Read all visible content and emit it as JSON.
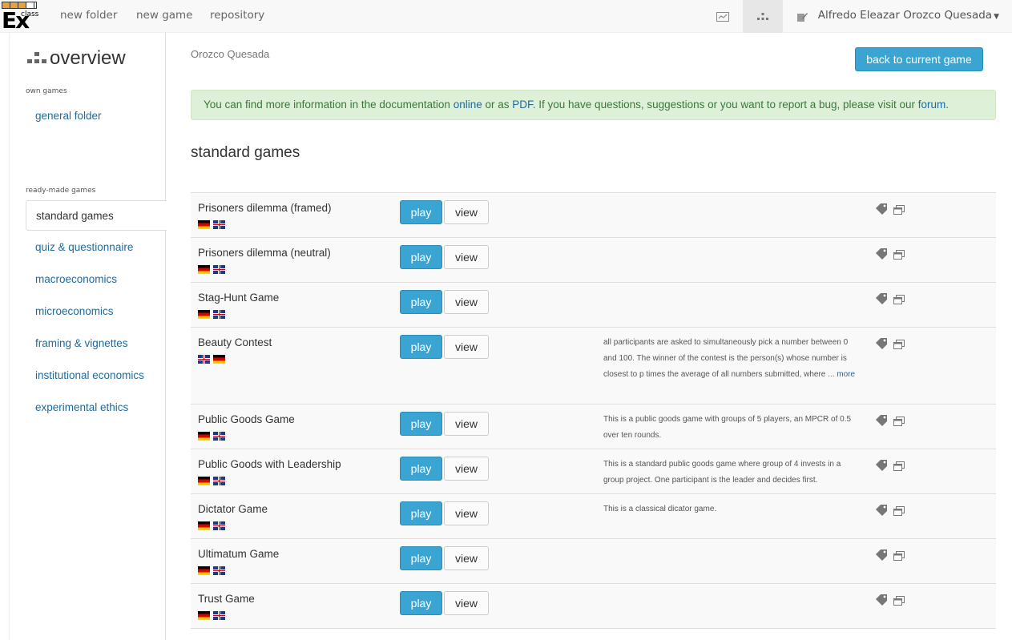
{
  "topnav": {
    "logo": {
      "text": "Ex",
      "small": "class"
    },
    "links": [
      "new folder",
      "new game",
      "repository"
    ],
    "icons": [
      "chart-icon",
      "sitemap-icon",
      "edit-icon"
    ],
    "user": "Alfredo Eleazar Orozco Quesada"
  },
  "sidebar": {
    "title": "overview",
    "own_caption": "own games",
    "own_items": [
      "general folder"
    ],
    "ready_caption": "ready-made games",
    "items": [
      "standard games",
      "quiz & questionnaire",
      "macroeconomics",
      "microeconomics",
      "framing & vignettes",
      "institutional economics",
      "experimental ethics"
    ],
    "active": "standard games"
  },
  "main": {
    "breadcrumb": "Orozco Quesada",
    "back_label": "back to current game",
    "info": {
      "pre": "You can find more information in the documentation ",
      "link1": "online",
      "mid": " or as ",
      "link2": "PDF",
      "post": ". If you have questions, suggestions or you want to report a bug, please visit our ",
      "link3": "forum",
      "end": "."
    },
    "section_title": "standard games",
    "play_label": "play",
    "view_label": "view",
    "more_label": "... more",
    "games": [
      {
        "name": "Prisoners dilemma (framed)",
        "flags": [
          "de",
          "gb"
        ],
        "desc": "",
        "more": false
      },
      {
        "name": "Prisoners dilemma (neutral)",
        "flags": [
          "de",
          "gb"
        ],
        "desc": "",
        "more": false
      },
      {
        "name": "Stag-Hunt Game",
        "flags": [
          "de",
          "gb"
        ],
        "desc": "",
        "more": false
      },
      {
        "name": "Beauty Contest",
        "flags": [
          "gb",
          "de"
        ],
        "desc": "all participants are asked to simultaneously pick a number between 0 and 100. The winner of the contest is the person(s) whose number is closest to p times the average of all numbers submitted, where",
        "more": true
      },
      {
        "name": "Public Goods Game",
        "flags": [
          "de",
          "gb"
        ],
        "desc": "This is a public goods game with groups of 5 players, an MPCR of 0.5 over ten rounds.",
        "more": false
      },
      {
        "name": "Public Goods with Leadership",
        "flags": [
          "de",
          "gb"
        ],
        "desc": "This is a standard public goods game where group of 4 invests in a group project. One participant is the leader and decides first.",
        "more": false
      },
      {
        "name": "Dictator Game",
        "flags": [
          "de",
          "gb"
        ],
        "desc": "This is a classical dicator game.",
        "more": false
      },
      {
        "name": "Ultimatum Game",
        "flags": [
          "de",
          "gb"
        ],
        "desc": "",
        "more": false
      },
      {
        "name": "Trust Game",
        "flags": [
          "de",
          "gb"
        ],
        "desc": "",
        "more": false
      }
    ]
  }
}
